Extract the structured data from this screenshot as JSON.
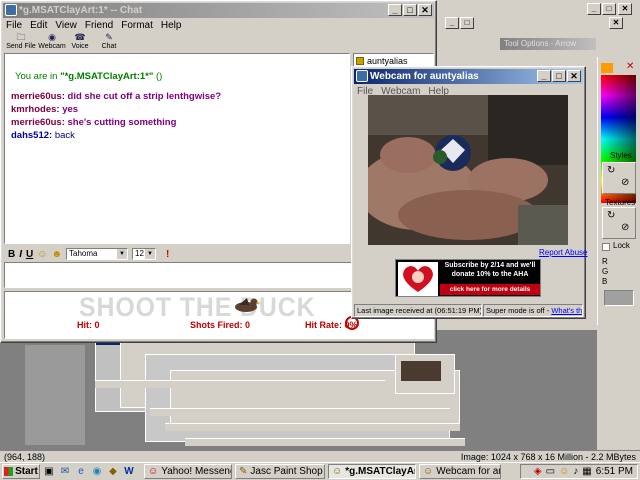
{
  "colors": {
    "title_active": "#0a246a",
    "desktop": "#808080",
    "chat_purple": "#800080",
    "link_blue": "#0000ff"
  },
  "chat": {
    "title": "*g.MSATClayArt:1* -- Chat",
    "menu": [
      "File",
      "Edit",
      "View",
      "Friend",
      "Format",
      "Help"
    ],
    "toolbar": [
      {
        "label": "Send File",
        "icon": "send-file-icon"
      },
      {
        "label": "Webcam",
        "icon": "webcam-icon"
      },
      {
        "label": "Voice",
        "icon": "voice-icon"
      },
      {
        "label": "Chat",
        "icon": "chat-icon"
      }
    ],
    "room_prefix": "You are in ",
    "room_name": "\"*g.MSATClayArt:1*\"",
    "room_suffix": " ()",
    "messages": [
      {
        "nick": "merrie60us:",
        "text": " did she cut off a strip lenthgwise?"
      },
      {
        "nick": "kmrhodes:",
        "text": " yes"
      },
      {
        "nick": "merrie60us:",
        "text": " she's cutting something"
      },
      {
        "nick": "dahs512:",
        "text": " back"
      }
    ],
    "format": {
      "bold": "B",
      "italic": "I",
      "underline": "U",
      "font": "Tahoma",
      "size": "12"
    },
    "users": [
      "auntyalias"
    ]
  },
  "game": {
    "title": "SHOOT THE DUCK",
    "hit_label": "Hit: 0",
    "shots_label": "Shots Fired: 0",
    "rate_label": "Hit Rate: 0%"
  },
  "webcam": {
    "title": "Webcam for auntyalias",
    "menu": [
      "File",
      "Webcam",
      "Help"
    ],
    "report_abuse": "Report Abuse",
    "ad_line1": "Subscribe by 2/14 and we'll",
    "ad_line2": "donate 10% to the AHA",
    "ad_cta": "click here for more details",
    "last_image": "Last image received at (06:51:19 PM)",
    "super_mode": "Super mode is off - ",
    "whats_this": "What's this?"
  },
  "psp": {
    "tool_options_title": "Tool Options - Arrow",
    "palette_labels": {
      "styles": "Styles",
      "textures": "Textures",
      "lock": "Lock",
      "r": "R",
      "g": "G",
      "b": "B"
    },
    "status_left": "(964, 188)",
    "status_right": "Image:  1024 x 768 x 16 Million - 2.2 MBytes"
  },
  "taskbar": {
    "start": "Start",
    "buttons": [
      {
        "label": "Yahoo! Messenger",
        "active": false
      },
      {
        "label": "Jasc Paint Shop Pro -...",
        "active": false
      },
      {
        "label": "*g.MSATClayArt:...",
        "active": true
      },
      {
        "label": "Webcam for auntyalias",
        "active": false
      }
    ],
    "clock": "6:51 PM"
  }
}
